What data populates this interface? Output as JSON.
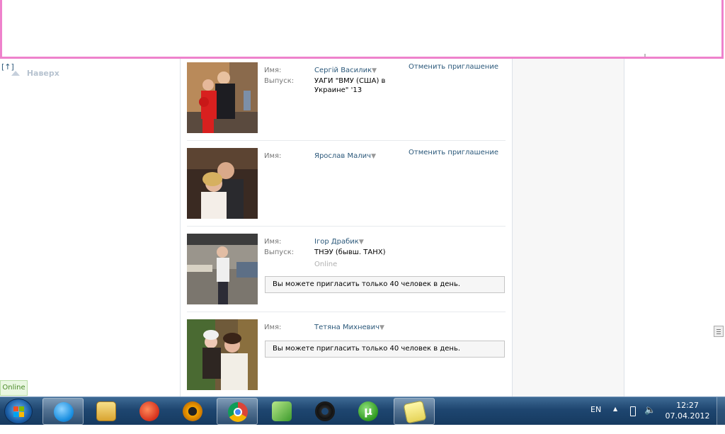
{
  "nav": {
    "up_bracket": "[↑]",
    "up_label": "Наверх"
  },
  "labels": {
    "name": "Имя:",
    "graduation": "Выпуск:",
    "caret": "▼"
  },
  "people": [
    {
      "name": "Сергій Василик",
      "graduation": "УАГИ \"ВМУ (США) в Украине\" '13",
      "action": "Отменить приглашение"
    },
    {
      "name": "Ярослав Малич",
      "action": "Отменить приглашение"
    },
    {
      "name": "Ігор Драбик",
      "graduation": "ТНЭУ (бывш. ТАНХ)",
      "status": "Online",
      "notice": "Вы можете пригласить только 40 человек в день."
    },
    {
      "name": "Тетяна Михневич",
      "notice": "Вы можете пригласить только 40 человек в день."
    }
  ],
  "online_badge": "Online",
  "taskbar": {
    "language": "EN",
    "time": "12:27",
    "date": "07.04.2012",
    "apps": [
      {
        "icon": "skype-icon",
        "active": true
      },
      {
        "icon": "file-explorer-icon",
        "active": false
      },
      {
        "icon": "ccleaner-icon",
        "active": false
      },
      {
        "icon": "aimp-icon",
        "active": false
      },
      {
        "icon": "chrome-icon",
        "active": true
      },
      {
        "icon": "3d-box-app-icon",
        "active": false
      },
      {
        "icon": "gear-app-icon",
        "active": false
      },
      {
        "icon": "utorrent-icon",
        "active": false
      },
      {
        "icon": "sticky-notes-icon",
        "active": true
      }
    ]
  },
  "colors": {
    "link": "#2b587a",
    "frame_border": "#ee82cc",
    "taskbar": "#1e4670"
  }
}
